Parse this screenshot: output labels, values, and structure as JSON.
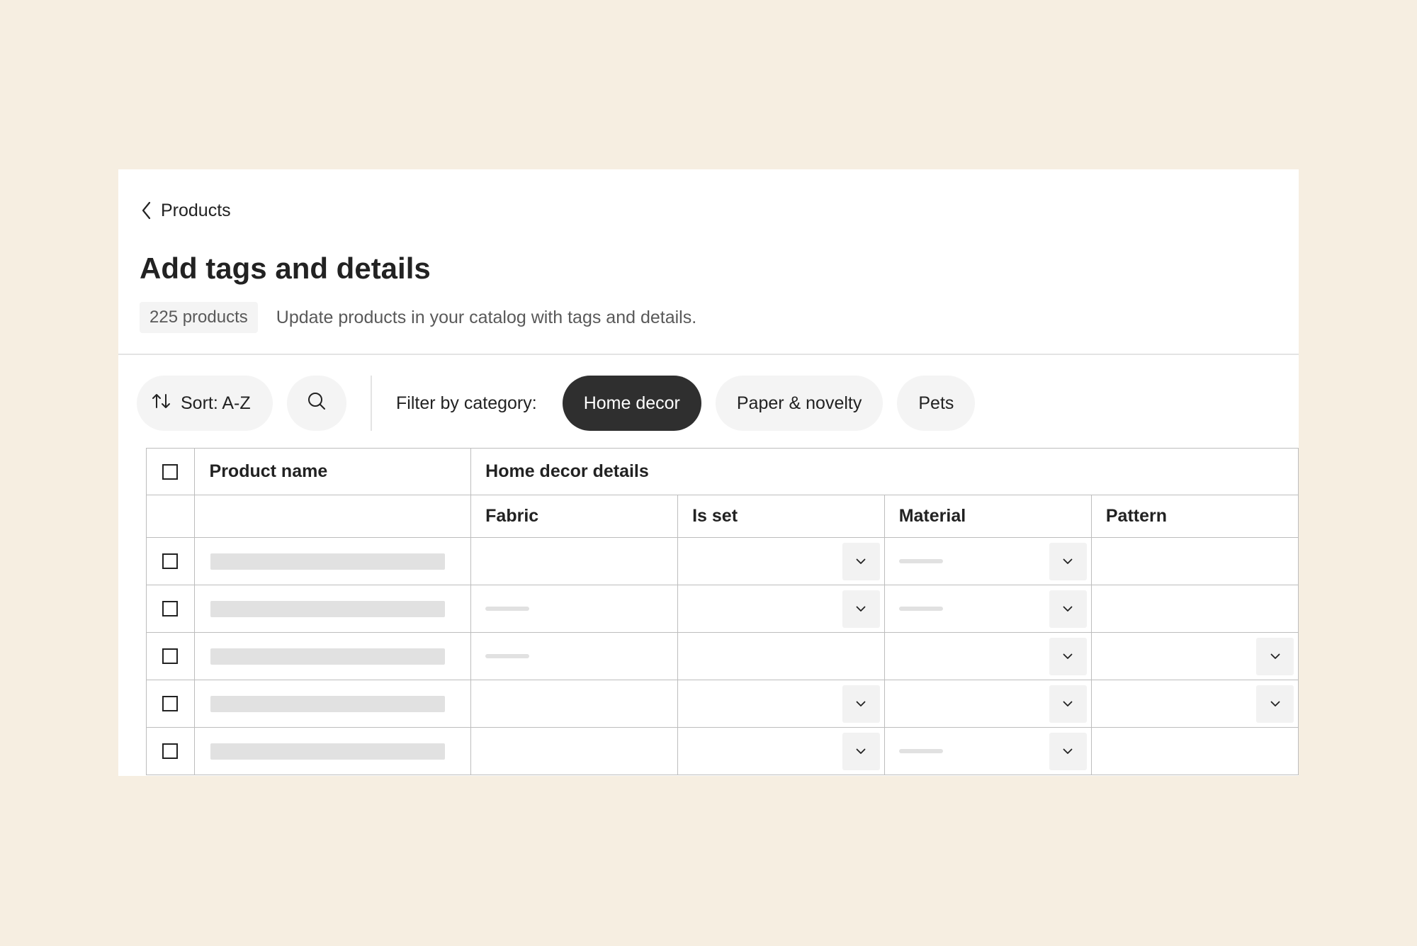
{
  "header": {
    "breadcrumb": "Products",
    "title": "Add tags and details",
    "count_badge": "225 products",
    "subtitle": "Update products in your catalog with tags and details."
  },
  "toolbar": {
    "sort_label": "Sort: A-Z",
    "filter_label": "Filter by category:",
    "categories": [
      {
        "label": "Home decor",
        "active": true
      },
      {
        "label": "Paper & novelty",
        "active": false
      },
      {
        "label": "Pets",
        "active": false
      }
    ]
  },
  "table": {
    "col_product_name": "Product name",
    "group_header": "Home decor details",
    "detail_columns": [
      "Fabric",
      "Is set",
      "Material",
      "Pattern"
    ],
    "rows": [
      {
        "fabric": {
          "value": false,
          "dropdown": false
        },
        "is_set": {
          "value": false,
          "dropdown": true
        },
        "material": {
          "value": true,
          "dropdown": true
        },
        "pattern": {
          "value": false,
          "dropdown": false
        }
      },
      {
        "fabric": {
          "value": true,
          "dropdown": false
        },
        "is_set": {
          "value": false,
          "dropdown": true
        },
        "material": {
          "value": true,
          "dropdown": true
        },
        "pattern": {
          "value": false,
          "dropdown": false
        }
      },
      {
        "fabric": {
          "value": true,
          "dropdown": false
        },
        "is_set": {
          "value": false,
          "dropdown": false
        },
        "material": {
          "value": false,
          "dropdown": true
        },
        "pattern": {
          "value": false,
          "dropdown": true
        }
      },
      {
        "fabric": {
          "value": false,
          "dropdown": false
        },
        "is_set": {
          "value": false,
          "dropdown": true
        },
        "material": {
          "value": false,
          "dropdown": true
        },
        "pattern": {
          "value": false,
          "dropdown": true
        }
      },
      {
        "fabric": {
          "value": false,
          "dropdown": false
        },
        "is_set": {
          "value": false,
          "dropdown": true
        },
        "material": {
          "value": true,
          "dropdown": true
        },
        "pattern": {
          "value": false,
          "dropdown": false
        }
      }
    ]
  },
  "colors": {
    "background": "#f6eee1",
    "panel": "#ffffff",
    "active_chip": "#2f2f2f",
    "chip": "#f4f4f4",
    "skeleton": "#e1e1e1",
    "border": "#bdbdbd"
  },
  "icons": {
    "back": "chevron-left-icon",
    "sort": "sort-arrows-icon",
    "search": "search-icon",
    "dropdown": "chevron-down-icon"
  }
}
